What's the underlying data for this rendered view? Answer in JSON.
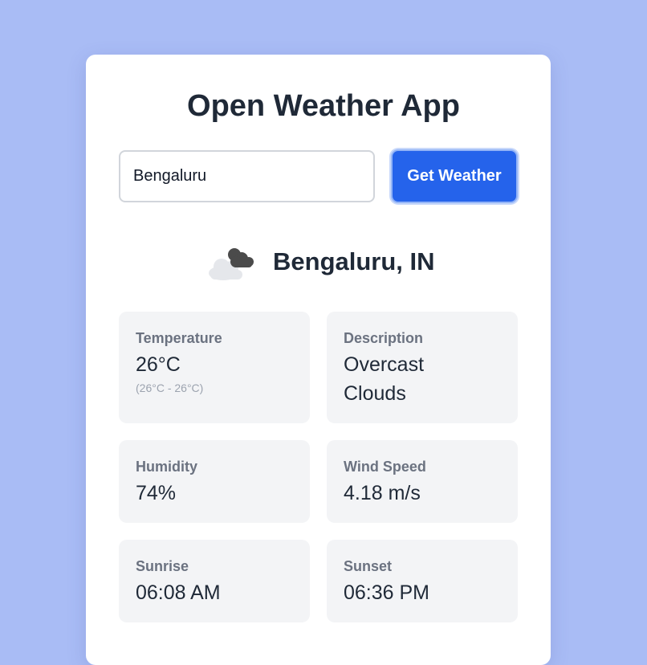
{
  "app": {
    "title": "Open Weather App"
  },
  "search": {
    "value": "Bengaluru",
    "button_label": "Get Weather"
  },
  "location": {
    "name": "Bengaluru, IN",
    "icon": "cloud-icon"
  },
  "details": {
    "temperature": {
      "label": "Temperature",
      "value": "26°C",
      "range": "(26°C - 26°C)"
    },
    "description": {
      "label": "Description",
      "value": "Overcast Clouds"
    },
    "humidity": {
      "label": "Humidity",
      "value": "74%"
    },
    "wind_speed": {
      "label": "Wind Speed",
      "value": "4.18 m/s"
    },
    "sunrise": {
      "label": "Sunrise",
      "value": "06:08 AM"
    },
    "sunset": {
      "label": "Sunset",
      "value": "06:36 PM"
    }
  },
  "colors": {
    "background": "#a9bcf5",
    "accent": "#2563eb",
    "tile": "#f3f4f6"
  }
}
